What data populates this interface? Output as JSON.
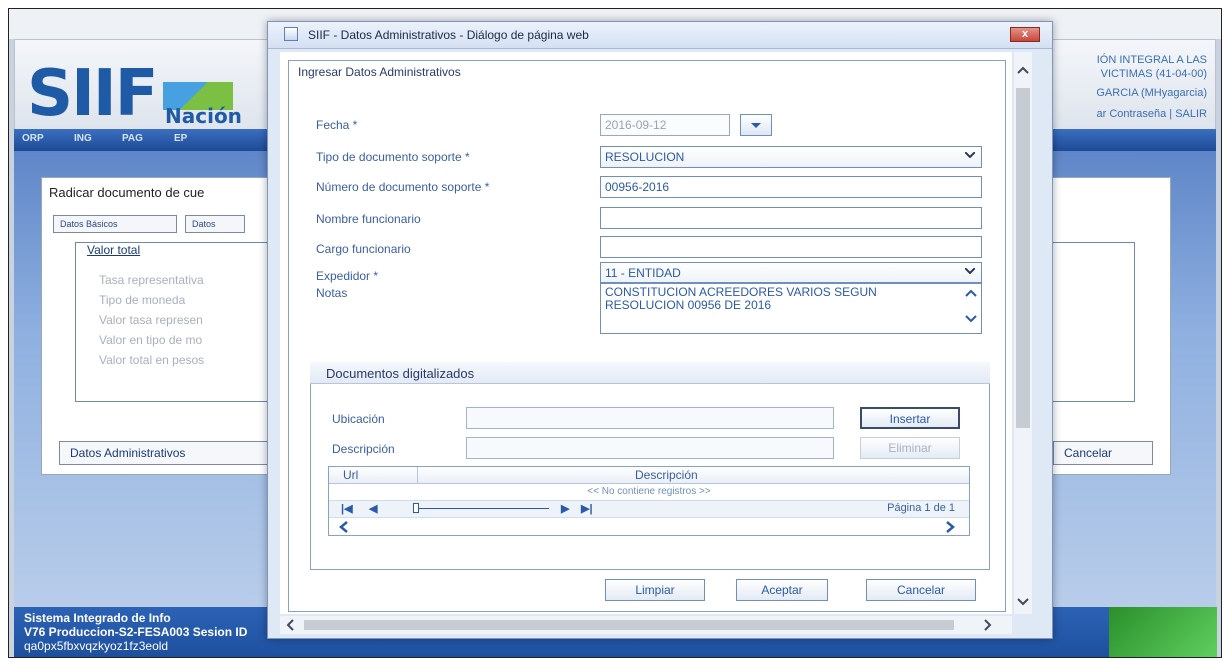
{
  "background": {
    "header": {
      "right_line1": "IÓN INTEGRAL A LAS",
      "right_line2": "VICTIMAS (41-04-00)",
      "right_line3": "GARCIA (MHyagarcia)",
      "right_line4": "ar Contraseña | SALIR"
    },
    "logo": {
      "text": "SIIF",
      "subtext": "Nación"
    },
    "nav": [
      "ORP",
      "ING",
      "PAG",
      "EP"
    ],
    "panel_title": "Radicar documento de cue",
    "tabs": [
      "Datos Básicos",
      "Datos"
    ],
    "valor_total": {
      "title": "Valor total",
      "items": [
        "Tasa representativa",
        "Tipo de moneda",
        "Valor tasa represen",
        "Valor en tipo de mo",
        "Valor total en pesos"
      ]
    },
    "buttons": {
      "admin": "Datos Administrativos",
      "cancel": "Cancelar"
    },
    "footer": {
      "line1": "Sistema Integrado de Info",
      "line2": "V76 Produccion-S2-FESA003 Sesion ID",
      "line3": "qa0px5fbxvqzkyoz1fz3eold"
    }
  },
  "dialog": {
    "title": "SIIF - Datos Administrativos - Diálogo de página web",
    "close_label": "x",
    "legend": "Ingresar Datos Administrativos",
    "fields": {
      "fecha": {
        "label": "Fecha *",
        "value": "2016-09-12"
      },
      "tipo_doc": {
        "label": "Tipo de documento soporte *",
        "value": "RESOLUCION"
      },
      "numero_doc": {
        "label": "Número de documento soporte *",
        "value": "00956-2016"
      },
      "nombre": {
        "label": "Nombre funcionario",
        "value": ""
      },
      "cargo": {
        "label": "Cargo funcionario",
        "value": ""
      },
      "expedidor": {
        "label": "Expedidor *",
        "value": "11 - ENTIDAD"
      },
      "notas": {
        "label": "Notas",
        "value": "CONSTITUCION ACREEDORES VARIOS SEGUN RESOLUCION 00956 DE 2016"
      }
    },
    "docs": {
      "title": "Documentos digitalizados",
      "ubicacion_label": "Ubicación",
      "descripcion_label": "Descripción",
      "insert_label": "Insertar",
      "delete_label": "Eliminar",
      "grid": {
        "col_url": "Url",
        "col_desc": "Descripción",
        "empty": "<< No contiene registros >>",
        "pager": "Página 1 de 1"
      }
    },
    "buttons": {
      "clear": "Limpiar",
      "accept": "Aceptar",
      "cancel": "Cancelar"
    }
  },
  "colors": {
    "accent": "#1f5aa6",
    "label_blue": "#3a5fa0",
    "footer_blue": "#1e4f9e",
    "green": "#5fd05f"
  }
}
